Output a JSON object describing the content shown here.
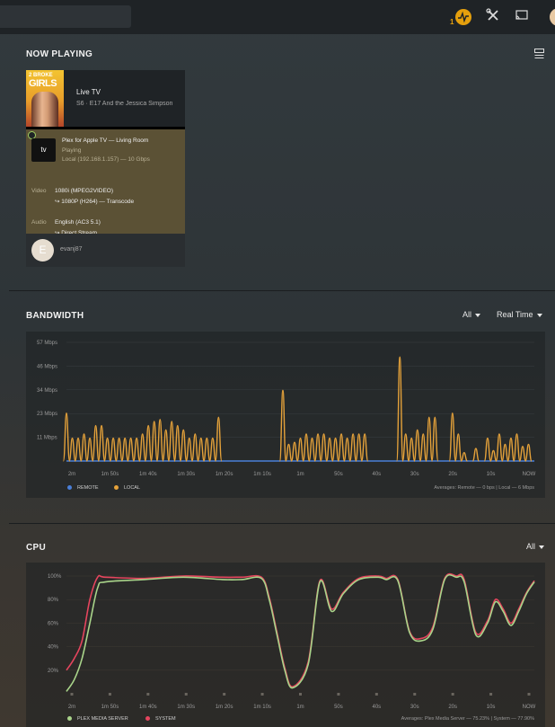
{
  "topbar": {
    "activity_count": "1",
    "icons": [
      "activity-icon",
      "tools-icon",
      "cast-icon",
      "avatar"
    ]
  },
  "now_playing": {
    "title": "NOW PLAYING",
    "item": {
      "poster_line1": "2 BROKE",
      "poster_line2": "GIRLS",
      "title": "Live TV",
      "subtitle": "S6 · E17 And the Jessica Simpson",
      "player": "Plex for Apple TV  —  Living Room",
      "state": "Playing",
      "network": "Local (192.168.1.157) — 10 Gbps",
      "appletv_logo": "tv",
      "video_label": "Video",
      "video_source": "1080i (MPEG2VIDEO)",
      "video_target": "↪  1080P (H264) — Transcode",
      "audio_label": "Audio",
      "audio_source": "English (AC3 5.1)",
      "audio_target": "↪  Direct Stream",
      "user_initial": "E",
      "user": "evanj87"
    }
  },
  "bandwidth": {
    "title": "BANDWIDTH",
    "filter": "All",
    "range": "Real Time",
    "legend": [
      "REMOTE",
      "LOCAL"
    ],
    "averages": "Averages: Remote — 0 bps | Local — 6 Mbps",
    "colors": {
      "remote": "#4a7fd8",
      "local": "#e5a23a"
    }
  },
  "cpu": {
    "title": "CPU",
    "filter": "All",
    "legend": [
      "PLEX MEDIA SERVER",
      "SYSTEM"
    ],
    "averages": "Averages: Plex Media Server — 75.23% | System — 77.90%",
    "colors": {
      "pms": "#a9d48a",
      "system": "#e5455e"
    }
  },
  "chart_data": [
    {
      "type": "line",
      "title": "BANDWIDTH",
      "x_ticks": [
        "2m",
        "1m 50s",
        "1m 40s",
        "1m 30s",
        "1m 20s",
        "1m 10s",
        "1m",
        "50s",
        "40s",
        "30s",
        "20s",
        "10s",
        "NOW"
      ],
      "y_ticks": [
        "11 Mbps",
        "23 Mbps",
        "34 Mbps",
        "46 Mbps",
        "57 Mbps"
      ],
      "ylim": [
        0,
        57
      ],
      "series": [
        {
          "name": "REMOTE",
          "values": [
            0
          ]
        },
        {
          "name": "LOCAL",
          "spikes": [
            [
              0,
              23
            ],
            [
              0.5,
              11
            ],
            [
              1,
              11
            ],
            [
              1.5,
              13
            ],
            [
              2,
              11
            ],
            [
              2.5,
              17
            ],
            [
              3,
              17
            ],
            [
              3.5,
              11
            ],
            [
              4,
              11
            ],
            [
              4.5,
              11
            ],
            [
              5,
              11
            ],
            [
              5.5,
              11
            ],
            [
              6,
              11
            ],
            [
              6.5,
              13
            ],
            [
              7,
              17
            ],
            [
              7.5,
              19
            ],
            [
              8,
              20
            ],
            [
              8.5,
              15
            ],
            [
              9,
              19
            ],
            [
              9.5,
              17
            ],
            [
              10,
              15
            ],
            [
              10.5,
              11
            ],
            [
              11,
              13
            ],
            [
              11.5,
              11
            ],
            [
              12,
              11
            ],
            [
              12.5,
              11
            ],
            [
              13,
              21
            ],
            [
              18.5,
              34
            ],
            [
              19,
              8
            ],
            [
              19.5,
              9
            ],
            [
              20,
              11
            ],
            [
              20.5,
              13
            ],
            [
              21,
              11
            ],
            [
              21.5,
              13
            ],
            [
              22,
              13
            ],
            [
              22.5,
              11
            ],
            [
              23,
              11
            ],
            [
              23.5,
              13
            ],
            [
              24,
              11
            ],
            [
              24.5,
              13
            ],
            [
              25,
              13
            ],
            [
              25.5,
              13
            ],
            [
              28.5,
              50
            ],
            [
              29,
              13
            ],
            [
              29.5,
              11
            ],
            [
              30,
              15
            ],
            [
              30.5,
              13
            ],
            [
              31,
              21
            ],
            [
              31.5,
              21
            ],
            [
              33,
              23
            ],
            [
              33.5,
              13
            ],
            [
              34,
              4
            ],
            [
              35,
              6
            ],
            [
              36,
              11
            ],
            [
              36.5,
              5
            ],
            [
              37,
              13
            ],
            [
              37.5,
              8
            ],
            [
              38,
              11
            ],
            [
              38.5,
              13
            ],
            [
              39,
              7
            ],
            [
              39.5,
              8
            ]
          ]
        }
      ]
    },
    {
      "type": "line",
      "title": "CPU",
      "x_ticks": [
        "2m",
        "1m 50s",
        "1m 40s",
        "1m 30s",
        "1m 20s",
        "1m 10s",
        "1m",
        "50s",
        "40s",
        "30s",
        "20s",
        "10s",
        "NOW"
      ],
      "y_ticks": [
        "20%",
        "40%",
        "60%",
        "80%",
        "100%"
      ],
      "ylim": [
        0,
        100
      ],
      "x_seconds": [
        120,
        118,
        116,
        114,
        112,
        110,
        100,
        90,
        80,
        75,
        70,
        68,
        66,
        64,
        62,
        58,
        55,
        52,
        49,
        45,
        40,
        38,
        35,
        32,
        29,
        26,
        23,
        20,
        18,
        15,
        12,
        10,
        8,
        6,
        4,
        2,
        0
      ],
      "series": [
        {
          "name": "PLEX MEDIA SERVER",
          "values": [
            2,
            12,
            30,
            60,
            90,
            95,
            97,
            99,
            97,
            97,
            98,
            80,
            50,
            20,
            5,
            25,
            95,
            70,
            85,
            97,
            99,
            97,
            96,
            52,
            45,
            55,
            97,
            99,
            95,
            50,
            60,
            78,
            70,
            58,
            70,
            85,
            95
          ]
        },
        {
          "name": "SYSTEM",
          "values": [
            20,
            30,
            45,
            80,
            99,
            99,
            98,
            100,
            99,
            99,
            99,
            82,
            52,
            22,
            6,
            27,
            96,
            72,
            86,
            98,
            100,
            98,
            97,
            53,
            47,
            57,
            98,
            100,
            97,
            52,
            62,
            80,
            72,
            60,
            72,
            86,
            96
          ]
        }
      ]
    }
  ]
}
